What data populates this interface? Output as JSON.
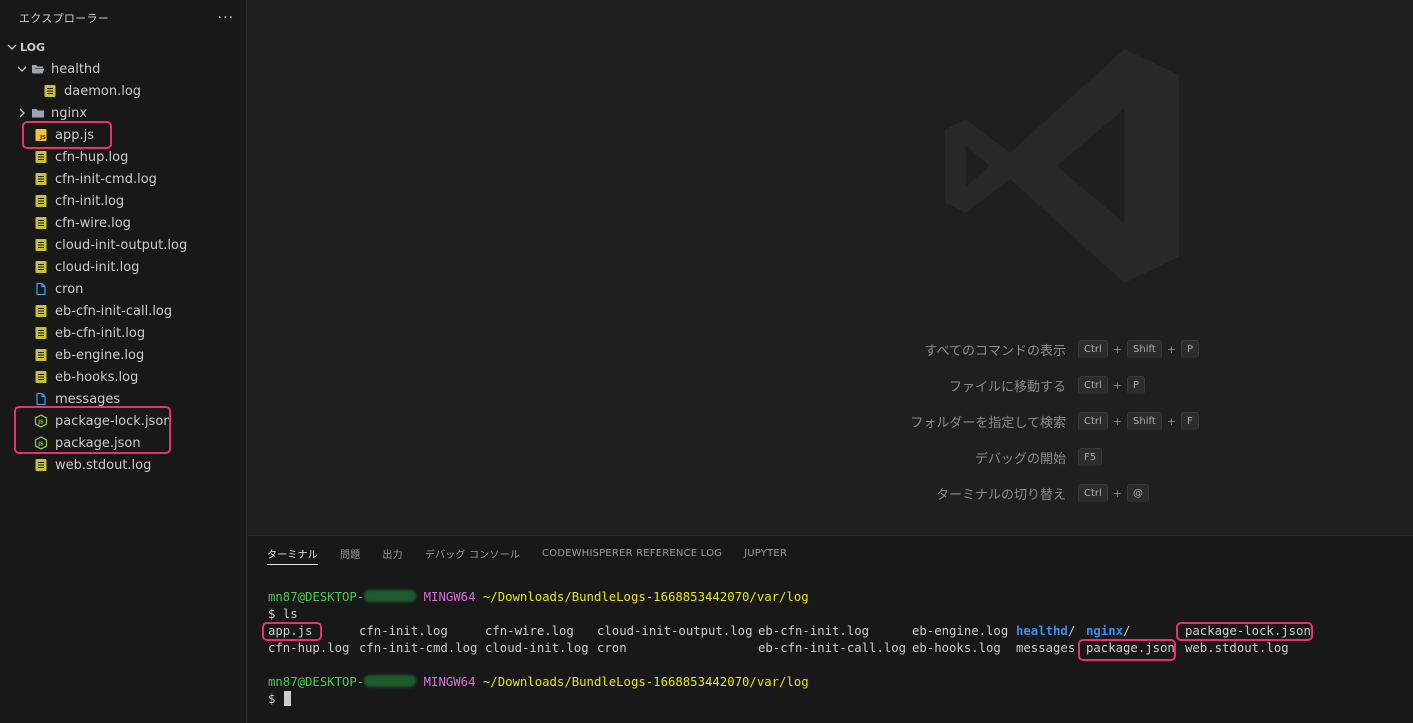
{
  "explorer": {
    "title": "エクスプローラー",
    "more": "···",
    "section": "LOG",
    "items": [
      {
        "label": "healthd",
        "kind": "folder-open"
      },
      {
        "label": "daemon.log",
        "kind": "log"
      },
      {
        "label": "nginx",
        "kind": "folder"
      },
      {
        "label": "app.js",
        "kind": "js"
      },
      {
        "label": "cfn-hup.log",
        "kind": "log"
      },
      {
        "label": "cfn-init-cmd.log",
        "kind": "log"
      },
      {
        "label": "cfn-init.log",
        "kind": "log"
      },
      {
        "label": "cfn-wire.log",
        "kind": "log"
      },
      {
        "label": "cloud-init-output.log",
        "kind": "log"
      },
      {
        "label": "cloud-init.log",
        "kind": "log"
      },
      {
        "label": "cron",
        "kind": "file"
      },
      {
        "label": "eb-cfn-init-call.log",
        "kind": "log"
      },
      {
        "label": "eb-cfn-init.log",
        "kind": "log"
      },
      {
        "label": "eb-engine.log",
        "kind": "log"
      },
      {
        "label": "eb-hooks.log",
        "kind": "log"
      },
      {
        "label": "messages",
        "kind": "file"
      },
      {
        "label": "package-lock.json",
        "kind": "node"
      },
      {
        "label": "package.json",
        "kind": "node"
      },
      {
        "label": "web.stdout.log",
        "kind": "log"
      }
    ]
  },
  "shortcuts": [
    {
      "label": "すべてのコマンドの表示",
      "keys": [
        "Ctrl",
        "Shift",
        "P"
      ]
    },
    {
      "label": "ファイルに移動する",
      "keys": [
        "Ctrl",
        "P"
      ]
    },
    {
      "label": "フォルダーを指定して検索",
      "keys": [
        "Ctrl",
        "Shift",
        "F"
      ]
    },
    {
      "label": "デバッグの開始",
      "keys": [
        "F5"
      ]
    },
    {
      "label": "ターミナルの切り替え",
      "keys": [
        "Ctrl",
        "@"
      ]
    }
  ],
  "panel": {
    "tabs": [
      "ターミナル",
      "問題",
      "出力",
      "デバッグ コンソール",
      "CODEWHISPERER REFERENCE LOG",
      "JUPYTER"
    ],
    "active_tab": "ターミナル"
  },
  "terminal": {
    "user": "mn87@DESKTOP-",
    "env": "MINGW64",
    "path": "~/Downloads/BundleLogs-1668853442070/var/log",
    "prompt": "$",
    "command": "ls",
    "ls_row1": [
      "app.js",
      "cfn-init.log",
      "cfn-wire.log",
      "cloud-init-output.log",
      "eb-cfn-init.log",
      "eb-engine.log",
      "healthd",
      "/",
      "nginx",
      "/",
      "package-lock.json"
    ],
    "ls_row2": [
      "cfn-hup.log",
      "cfn-init-cmd.log",
      "cloud-init.log",
      "cron",
      "eb-cfn-init-call.log",
      "eb-hooks.log",
      "messages",
      "package.json",
      "web.stdout.log"
    ]
  },
  "colors": {
    "highlight": "#e8326e",
    "log_icon": "#c5c035",
    "js_icon": "#f1c232",
    "node_icon": "#8bc34a",
    "file_icon": "#4a9de0",
    "folder_icon": "#9aa7b3"
  }
}
